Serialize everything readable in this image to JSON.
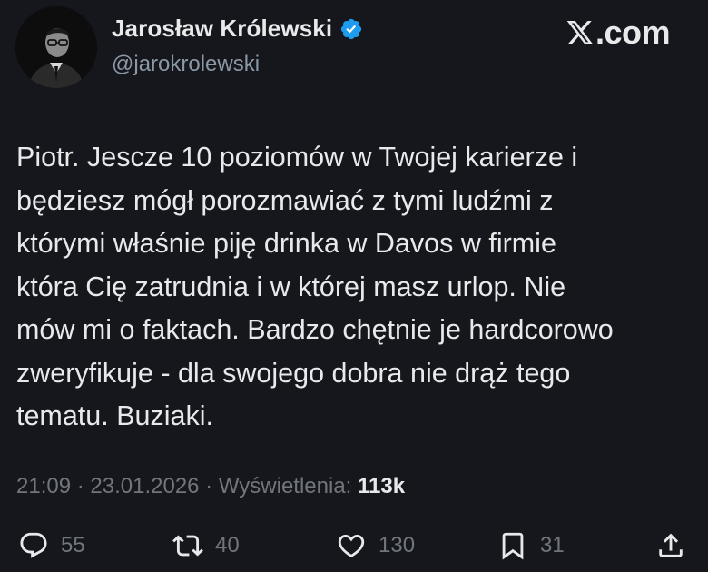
{
  "author": {
    "display_name": "Jarosław Królewski",
    "handle": "@jarokrolewski",
    "verified": true,
    "avatar_icon": "profile-photo"
  },
  "brand": {
    "logo_icon": "x-logo-icon",
    "domain_text": ".com"
  },
  "tweet": {
    "lines": [
      "Piotr. Jescze 10 poziomów w Twojej karierze i",
      "będziesz mógł porozmawiać z tymi ludźmi z",
      "którymi właśnie piję drinka w Davos w firmie",
      "która Cię zatrudnia i w której masz urlop. Nie",
      "mów mi o faktach. Bardzo chętnie je hardcorowo",
      "zweryfikuje - dla swojego dobra nie drąż tego",
      "tematu. Buziaki."
    ]
  },
  "meta": {
    "time": "21:09",
    "sep1": " · ",
    "date": "23.01.2026",
    "sep2": " · ",
    "views_label": "Wyświetlenia: ",
    "views_count": "113k"
  },
  "actions": {
    "replies": "55",
    "reposts": "40",
    "likes": "130",
    "bookmarks": "31"
  },
  "colors": {
    "background": "#15171c",
    "text": "#e7e9ea",
    "muted": "#71767b",
    "verified": "#1d9bf0"
  }
}
